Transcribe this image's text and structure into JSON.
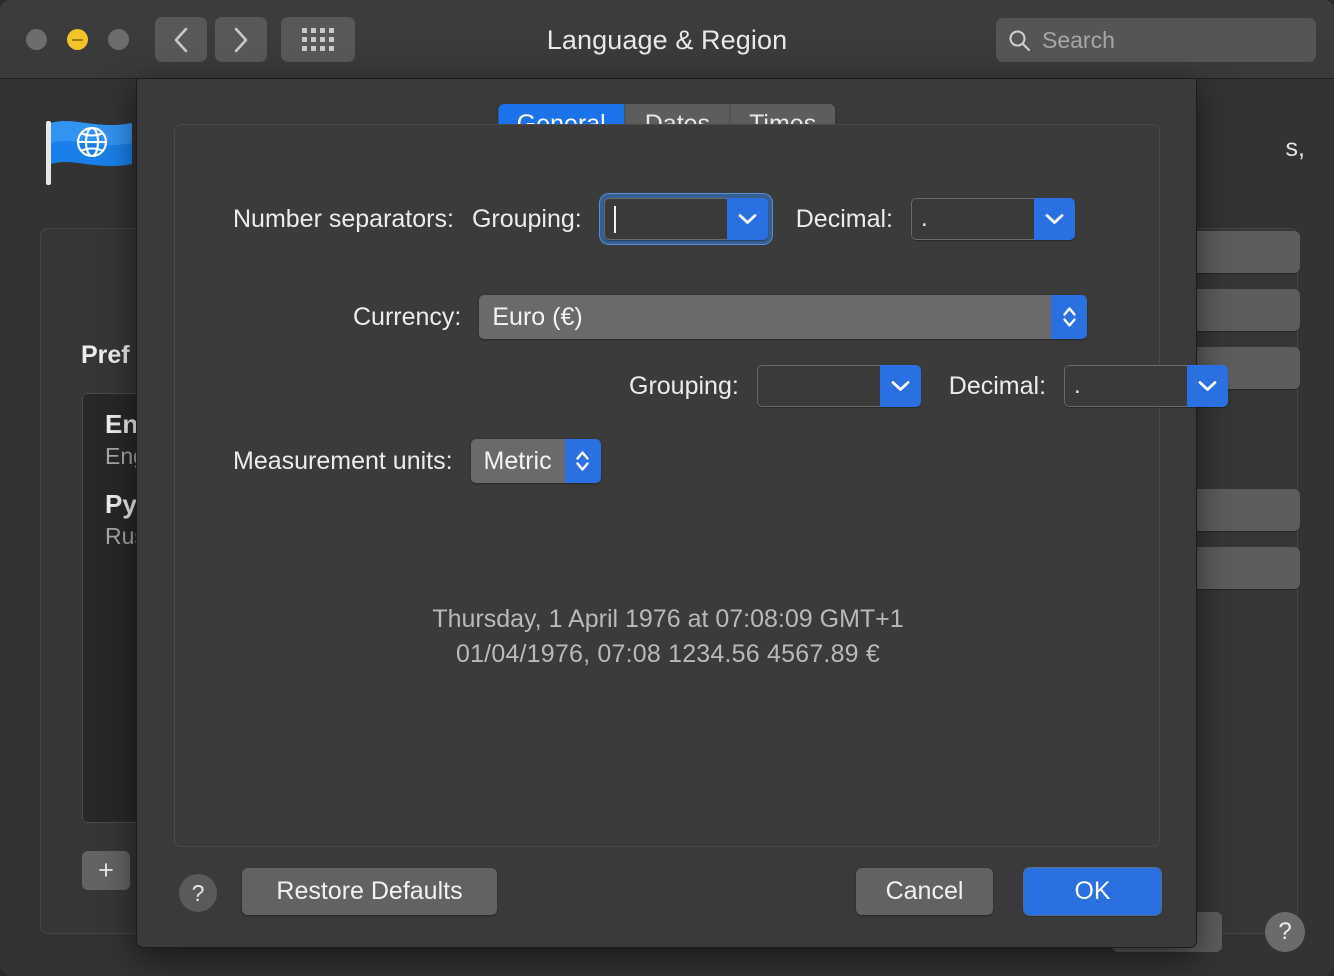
{
  "window": {
    "title": "Language & Region",
    "traffic_lights": [
      "close-button",
      "minimize-button",
      "zoom-button"
    ],
    "back_icon": "chevron-left-icon",
    "forward_icon": "chevron-right-icon",
    "grid_icon": "show-all-grid-icon",
    "search": {
      "placeholder": "Search",
      "icon": "search-icon",
      "value": ""
    }
  },
  "background": {
    "app_icon": "flag-globe-icon",
    "description_fragment": "s,",
    "panel_title_fragment": "Pref",
    "languages": [
      {
        "name": "Eng",
        "sub": "Eng"
      },
      {
        "name": "Pyc",
        "sub": "Rus"
      }
    ],
    "add_button_label": "+",
    "help_button_label": "?"
  },
  "sheet": {
    "tabs": [
      {
        "label": "General",
        "selected": true
      },
      {
        "label": "Dates",
        "selected": false
      },
      {
        "label": "Times",
        "selected": false
      }
    ],
    "fields": {
      "number_separators_label": "Number separators:",
      "grouping_label": "Grouping:",
      "decimal_label": "Decimal:",
      "currency_label": "Currency:",
      "measurement_label": "Measurement units:",
      "number_grouping_value": "",
      "number_decimal_value": ".",
      "currency_value": "Euro (€)",
      "currency_grouping_value": "",
      "currency_decimal_value": ".",
      "measurement_value": "Metric"
    },
    "preview": {
      "line1": "Thursday, 1 April 1976 at 07:08:09 GMT+1",
      "line2": "01/04/1976, 07:08     1234.56     4567.89 €"
    },
    "footer": {
      "help_label": "?",
      "restore_label": "Restore Defaults",
      "cancel_label": "Cancel",
      "ok_label": "OK"
    }
  },
  "colors": {
    "accent_blue": "#2a70e0",
    "tab_selected_blue": "#1c72e8",
    "window_bg": "#333333",
    "sheet_bg": "#3a3a3a",
    "minimize_yellow": "#f3c32c"
  }
}
